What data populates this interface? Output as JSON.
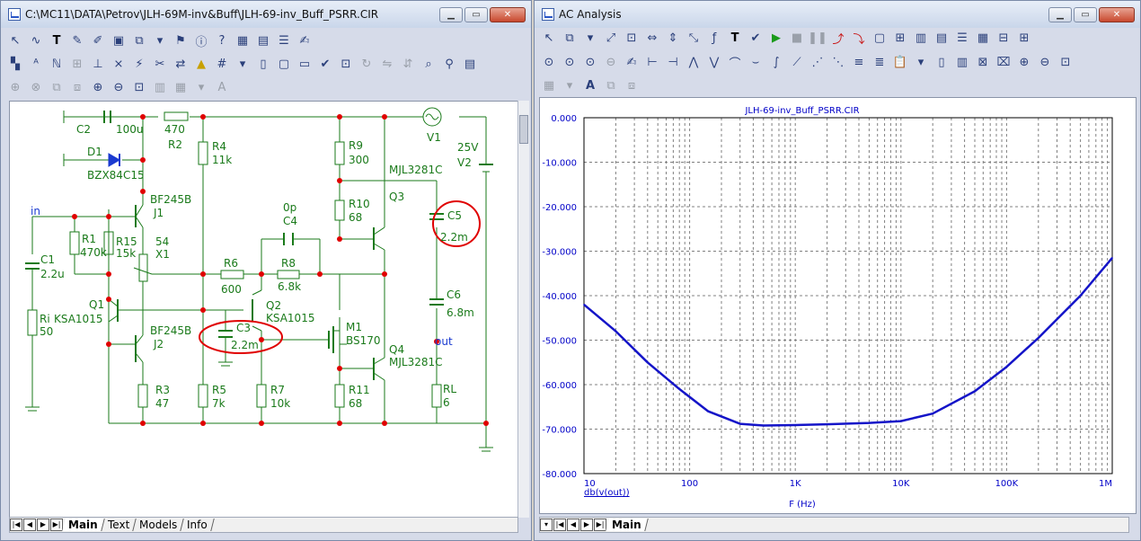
{
  "left_window": {
    "title": "C:\\MC11\\DATA\\Petrov\\JLH-69M-inv&Buff\\JLH-69-inv_Buff_PSRR.CIR",
    "tabs": [
      "Main",
      "Text",
      "Models",
      "Info"
    ],
    "active_tab": "Main",
    "components": {
      "C2": {
        "name": "C2",
        "value": "100u"
      },
      "R2": {
        "name": "R2",
        "value": "470"
      },
      "D1": {
        "name": "D1",
        "value": "BZX84C15"
      },
      "R4": {
        "name": "R4",
        "value": "11k"
      },
      "R9": {
        "name": "R9",
        "value": "300"
      },
      "V1": {
        "name": "V1"
      },
      "V2": {
        "name": "V2",
        "value": "25V"
      },
      "Q3": {
        "name": "Q3",
        "value": "MJL3281C"
      },
      "J1": {
        "name": "J1",
        "value": "BF245B"
      },
      "C4": {
        "name": "C4",
        "value": "0p"
      },
      "R10": {
        "name": "R10",
        "value": "68"
      },
      "C5": {
        "name": "C5",
        "value": "2.2m"
      },
      "in": "in",
      "R1": {
        "name": "R1",
        "value": "470k"
      },
      "R15": {
        "name": "R15",
        "value": "15k"
      },
      "X1": {
        "name": "X1",
        "value": "54"
      },
      "C1": {
        "name": "C1",
        "value": "2.2u"
      },
      "R6": {
        "name": "R6",
        "value": "600"
      },
      "R8": {
        "name": "R8",
        "value": "6.8k"
      },
      "C6": {
        "name": "C6",
        "value": "6.8m"
      },
      "Q1": {
        "name": "Q1",
        "value": "KSA1015"
      },
      "Ri": {
        "name": "Ri",
        "value": "50"
      },
      "Q2": {
        "name": "Q2",
        "value": "KSA1015"
      },
      "J2": {
        "name": "J2",
        "value": "BF245B"
      },
      "C3": {
        "name": "C3",
        "value": "2.2m"
      },
      "M1": {
        "name": "M1",
        "value": "BS170"
      },
      "out": "out",
      "Q4": {
        "name": "Q4",
        "value": "MJL3281C"
      },
      "R3": {
        "name": "R3",
        "value": "47"
      },
      "R5": {
        "name": "R5",
        "value": "7k"
      },
      "R7": {
        "name": "R7",
        "value": "10k"
      },
      "R11": {
        "name": "R11",
        "value": "68"
      },
      "RL": {
        "name": "RL",
        "value": "6"
      }
    }
  },
  "right_window": {
    "title": "AC Analysis",
    "tabs": [
      "Main"
    ],
    "active_tab": "Main"
  },
  "chart_data": {
    "type": "line",
    "title": "JLH-69-inv_Buff_PSRR.CIR",
    "xlabel": "F (Hz)",
    "ylabel": "",
    "xscale": "log",
    "xlim": [
      10,
      1000000
    ],
    "ylim": [
      -80,
      0
    ],
    "x_ticks": [
      "10",
      "100",
      "1K",
      "10K",
      "100K",
      "1M"
    ],
    "y_ticks": [
      "0.000",
      "-10.000",
      "-20.000",
      "-30.000",
      "-40.000",
      "-50.000",
      "-60.000",
      "-70.000",
      "-80.000"
    ],
    "grid": true,
    "series": [
      {
        "name": "db(v(out))",
        "color": "#1414c8",
        "x": [
          10,
          20,
          40,
          80,
          150,
          300,
          500,
          1000,
          2000,
          5000,
          10000,
          20000,
          50000,
          100000,
          200000,
          500000,
          1000000
        ],
        "y": [
          -42,
          -48,
          -55,
          -61,
          -66,
          -68.8,
          -69.2,
          -69.1,
          -68.9,
          -68.6,
          -68.2,
          -66.5,
          -61.5,
          -56.0,
          -49.5,
          -40.0,
          -31.5
        ]
      }
    ]
  }
}
